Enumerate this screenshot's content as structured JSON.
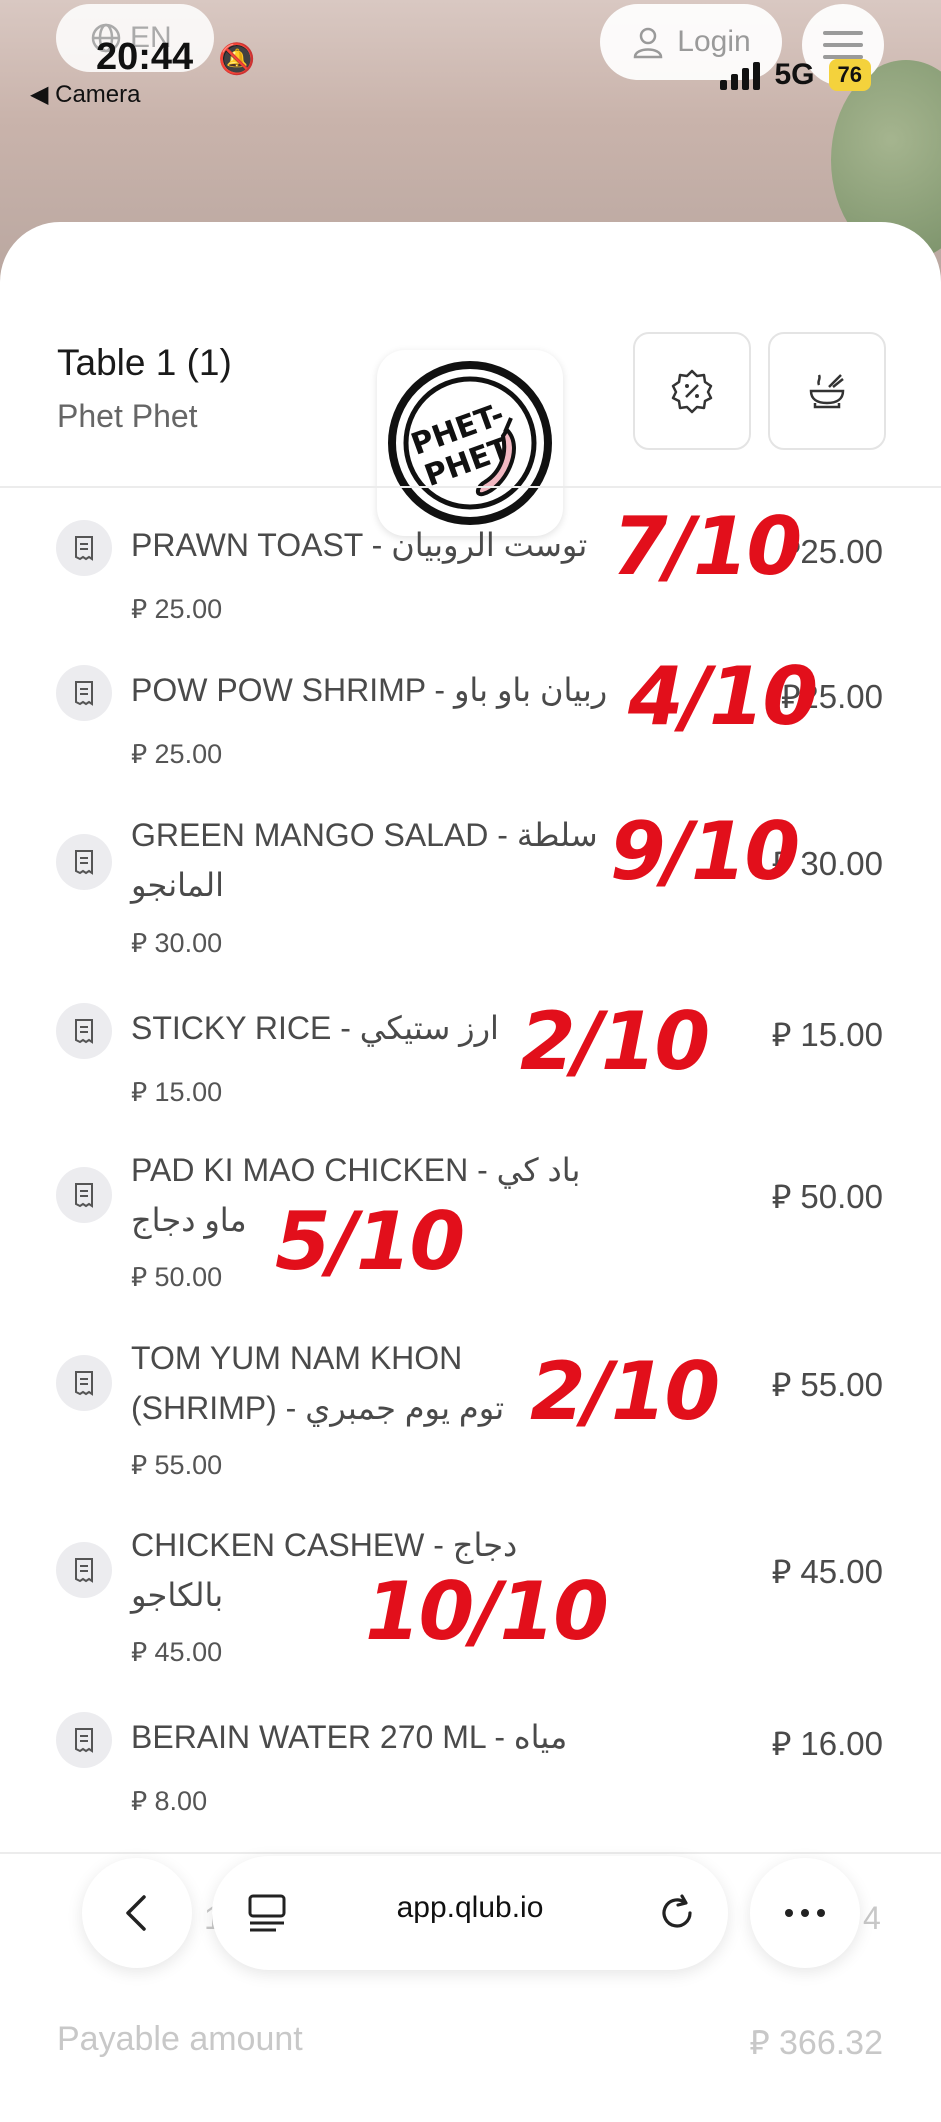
{
  "status_bar": {
    "time": "20:44",
    "back_app": "◀ Camera",
    "network": "5G",
    "battery": "76"
  },
  "top_nav": {
    "language": "EN",
    "login": "Login"
  },
  "header": {
    "table": "Table 1 (1)",
    "restaurant": "Phet Phet",
    "logo_text_1": "PHET-",
    "logo_text_2": "PHET"
  },
  "items": [
    {
      "name": "PRAWN TOAST - توست الروبيان",
      "unit_price": "⃁ 25.00",
      "total": "⃁25.00",
      "rating": "7/10"
    },
    {
      "name": "POW POW SHRIMP - ربيان باو باو",
      "unit_price": "⃁ 25.00",
      "total": "⃁25.00",
      "rating": "4/10"
    },
    {
      "name": "GREEN MANGO SALAD - سلطة المانجو",
      "unit_price": "⃁ 30.00",
      "total": "⃁ 30.00",
      "rating": "9/10"
    },
    {
      "name": "STICKY RICE - ارز ستيكي",
      "unit_price": "⃁ 15.00",
      "total": "⃁ 15.00",
      "rating": "2/10"
    },
    {
      "name": "PAD KI MAO CHICKEN - باد كي ماو دجاج",
      "unit_price": "⃁ 50.00",
      "total": "⃁ 50.00",
      "rating": "5/10"
    },
    {
      "name": "TOM YUM NAM KHON (SHRIMP) - توم يوم جمبري",
      "unit_price": "⃁ 55.00",
      "total": "⃁ 55.00",
      "rating": "2/10"
    },
    {
      "name": "CHICKEN CASHEW - دجاج بالكاجو",
      "unit_price": "⃁ 45.00",
      "total": "⃁ 45.00",
      "rating": "10/10"
    },
    {
      "name": "BERAIN WATER 270 ML - مياه",
      "unit_price": "⃁ 8.00",
      "total": "⃁ 16.00",
      "rating": ""
    }
  ],
  "partial": {
    "qty": "1",
    "right": "4",
    "payable_label": "Payable amount",
    "payable_value": "⃁ 366.32"
  },
  "browser": {
    "url": "app.qlub.io"
  },
  "colors": {
    "rating_ink": "#e20f1b",
    "battery": "#f4d23c"
  }
}
